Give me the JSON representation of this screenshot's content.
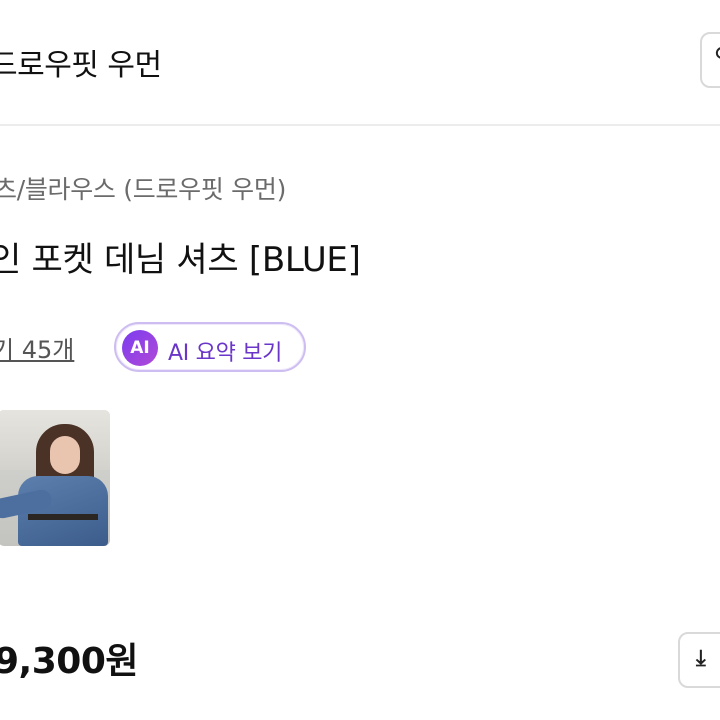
{
  "header": {
    "brand_title": "드로우핏 우먼",
    "right_button_icon": "search-icon"
  },
  "product": {
    "category": "츠/블라우스 (드로우핏 우먼)",
    "title": "인 포켓 데님 셔츠 [BLUE]",
    "review_link": "기 45개",
    "ai_button": {
      "badge": "AI",
      "label": "AI 요약 보기"
    },
    "price": "9,300원",
    "download_icon": "download-icon"
  },
  "colors": {
    "ai_purple": "#7a3cf0",
    "ai_border": "#cdbdf0",
    "category_gray": "#6b6b6b"
  }
}
